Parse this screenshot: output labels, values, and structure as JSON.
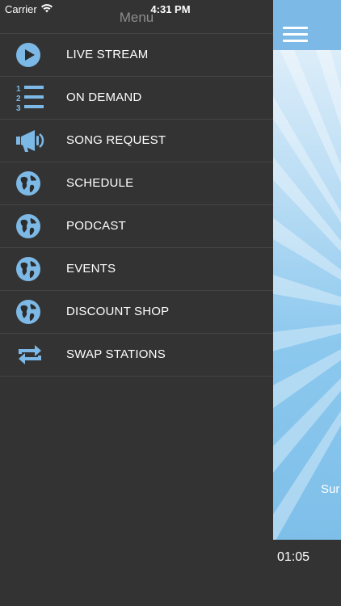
{
  "status_bar": {
    "carrier": "Carrier",
    "time": "4:31 PM"
  },
  "menu": {
    "title": "Menu",
    "items": [
      {
        "label": "LIVE STREAM",
        "icon": "play-circle-icon"
      },
      {
        "label": "ON DEMAND",
        "icon": "numbered-list-icon"
      },
      {
        "label": "SONG REQUEST",
        "icon": "megaphone-icon"
      },
      {
        "label": "SCHEDULE",
        "icon": "globe-icon"
      },
      {
        "label": "PODCAST",
        "icon": "globe-icon"
      },
      {
        "label": "EVENTS",
        "icon": "globe-icon"
      },
      {
        "label": "DISCOUNT SHOP",
        "icon": "globe-icon"
      },
      {
        "label": "SWAP STATIONS",
        "icon": "swap-arrows-icon"
      }
    ]
  },
  "content": {
    "hero_text": "Sur",
    "player_time": "01:05"
  },
  "colors": {
    "accent": "#7db9e6",
    "menu_bg": "#333333",
    "icon": "#7db9e6"
  }
}
